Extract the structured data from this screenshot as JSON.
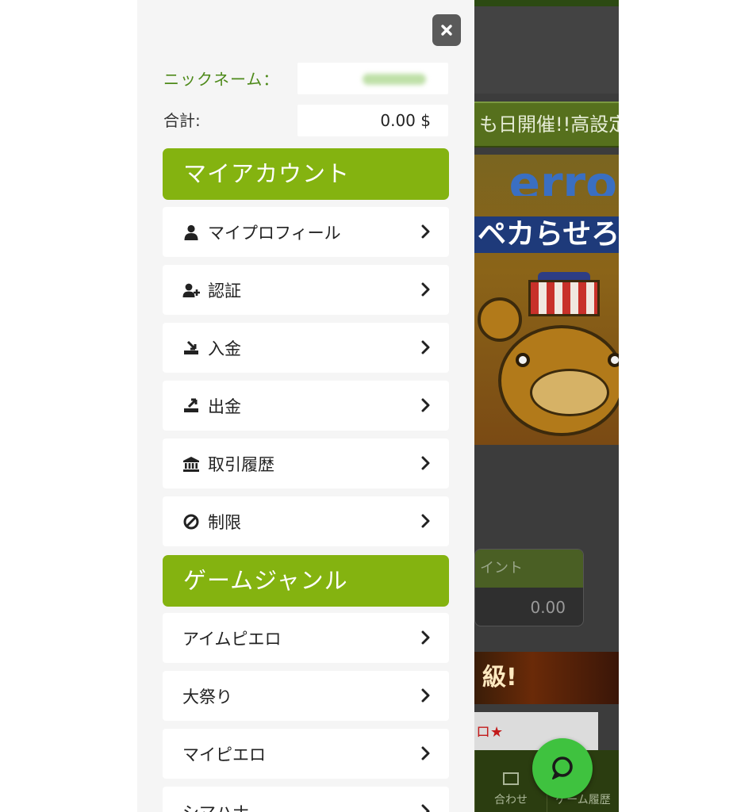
{
  "background": {
    "banner_text": "も日開催!!高設定",
    "promo_title": "erro",
    "promo_sub": "ペカらせろ",
    "points_label": "イント",
    "points_value": "0.00",
    "fire_text": "級!",
    "notice_text": "ロ★",
    "bottom_nav": [
      {
        "label": "合わせ",
        "icon": "mail-icon"
      },
      {
        "label": "ゲーム履歴",
        "icon": "history-icon"
      }
    ]
  },
  "drawer": {
    "close_icon": "close-icon",
    "nickname_label": "ニックネーム：",
    "total_label": "合計:",
    "total_value": "0.00 $",
    "account_section": {
      "title": "マイアカウント",
      "items": [
        {
          "label": "マイプロフィール",
          "icon": "user-icon"
        },
        {
          "label": "認証",
          "icon": "user-plus-icon"
        },
        {
          "label": "入金",
          "icon": "deposit-icon"
        },
        {
          "label": "出金",
          "icon": "withdraw-icon"
        },
        {
          "label": "取引履歴",
          "icon": "bank-icon"
        },
        {
          "label": "制限",
          "icon": "ban-icon"
        }
      ]
    },
    "genre_section": {
      "title": "ゲームジャンル",
      "items": [
        {
          "label": "アイムピエロ"
        },
        {
          "label": "大祭り"
        },
        {
          "label": "マイピエロ"
        },
        {
          "label": "シマハナ"
        }
      ]
    }
  },
  "chat_button": {
    "icon": "chat-icon",
    "color": "#3fc23f"
  },
  "colors": {
    "accent": "#84b310",
    "nickname_label": "#4e8a1a",
    "drawer_bg": "#f5f5f5"
  }
}
